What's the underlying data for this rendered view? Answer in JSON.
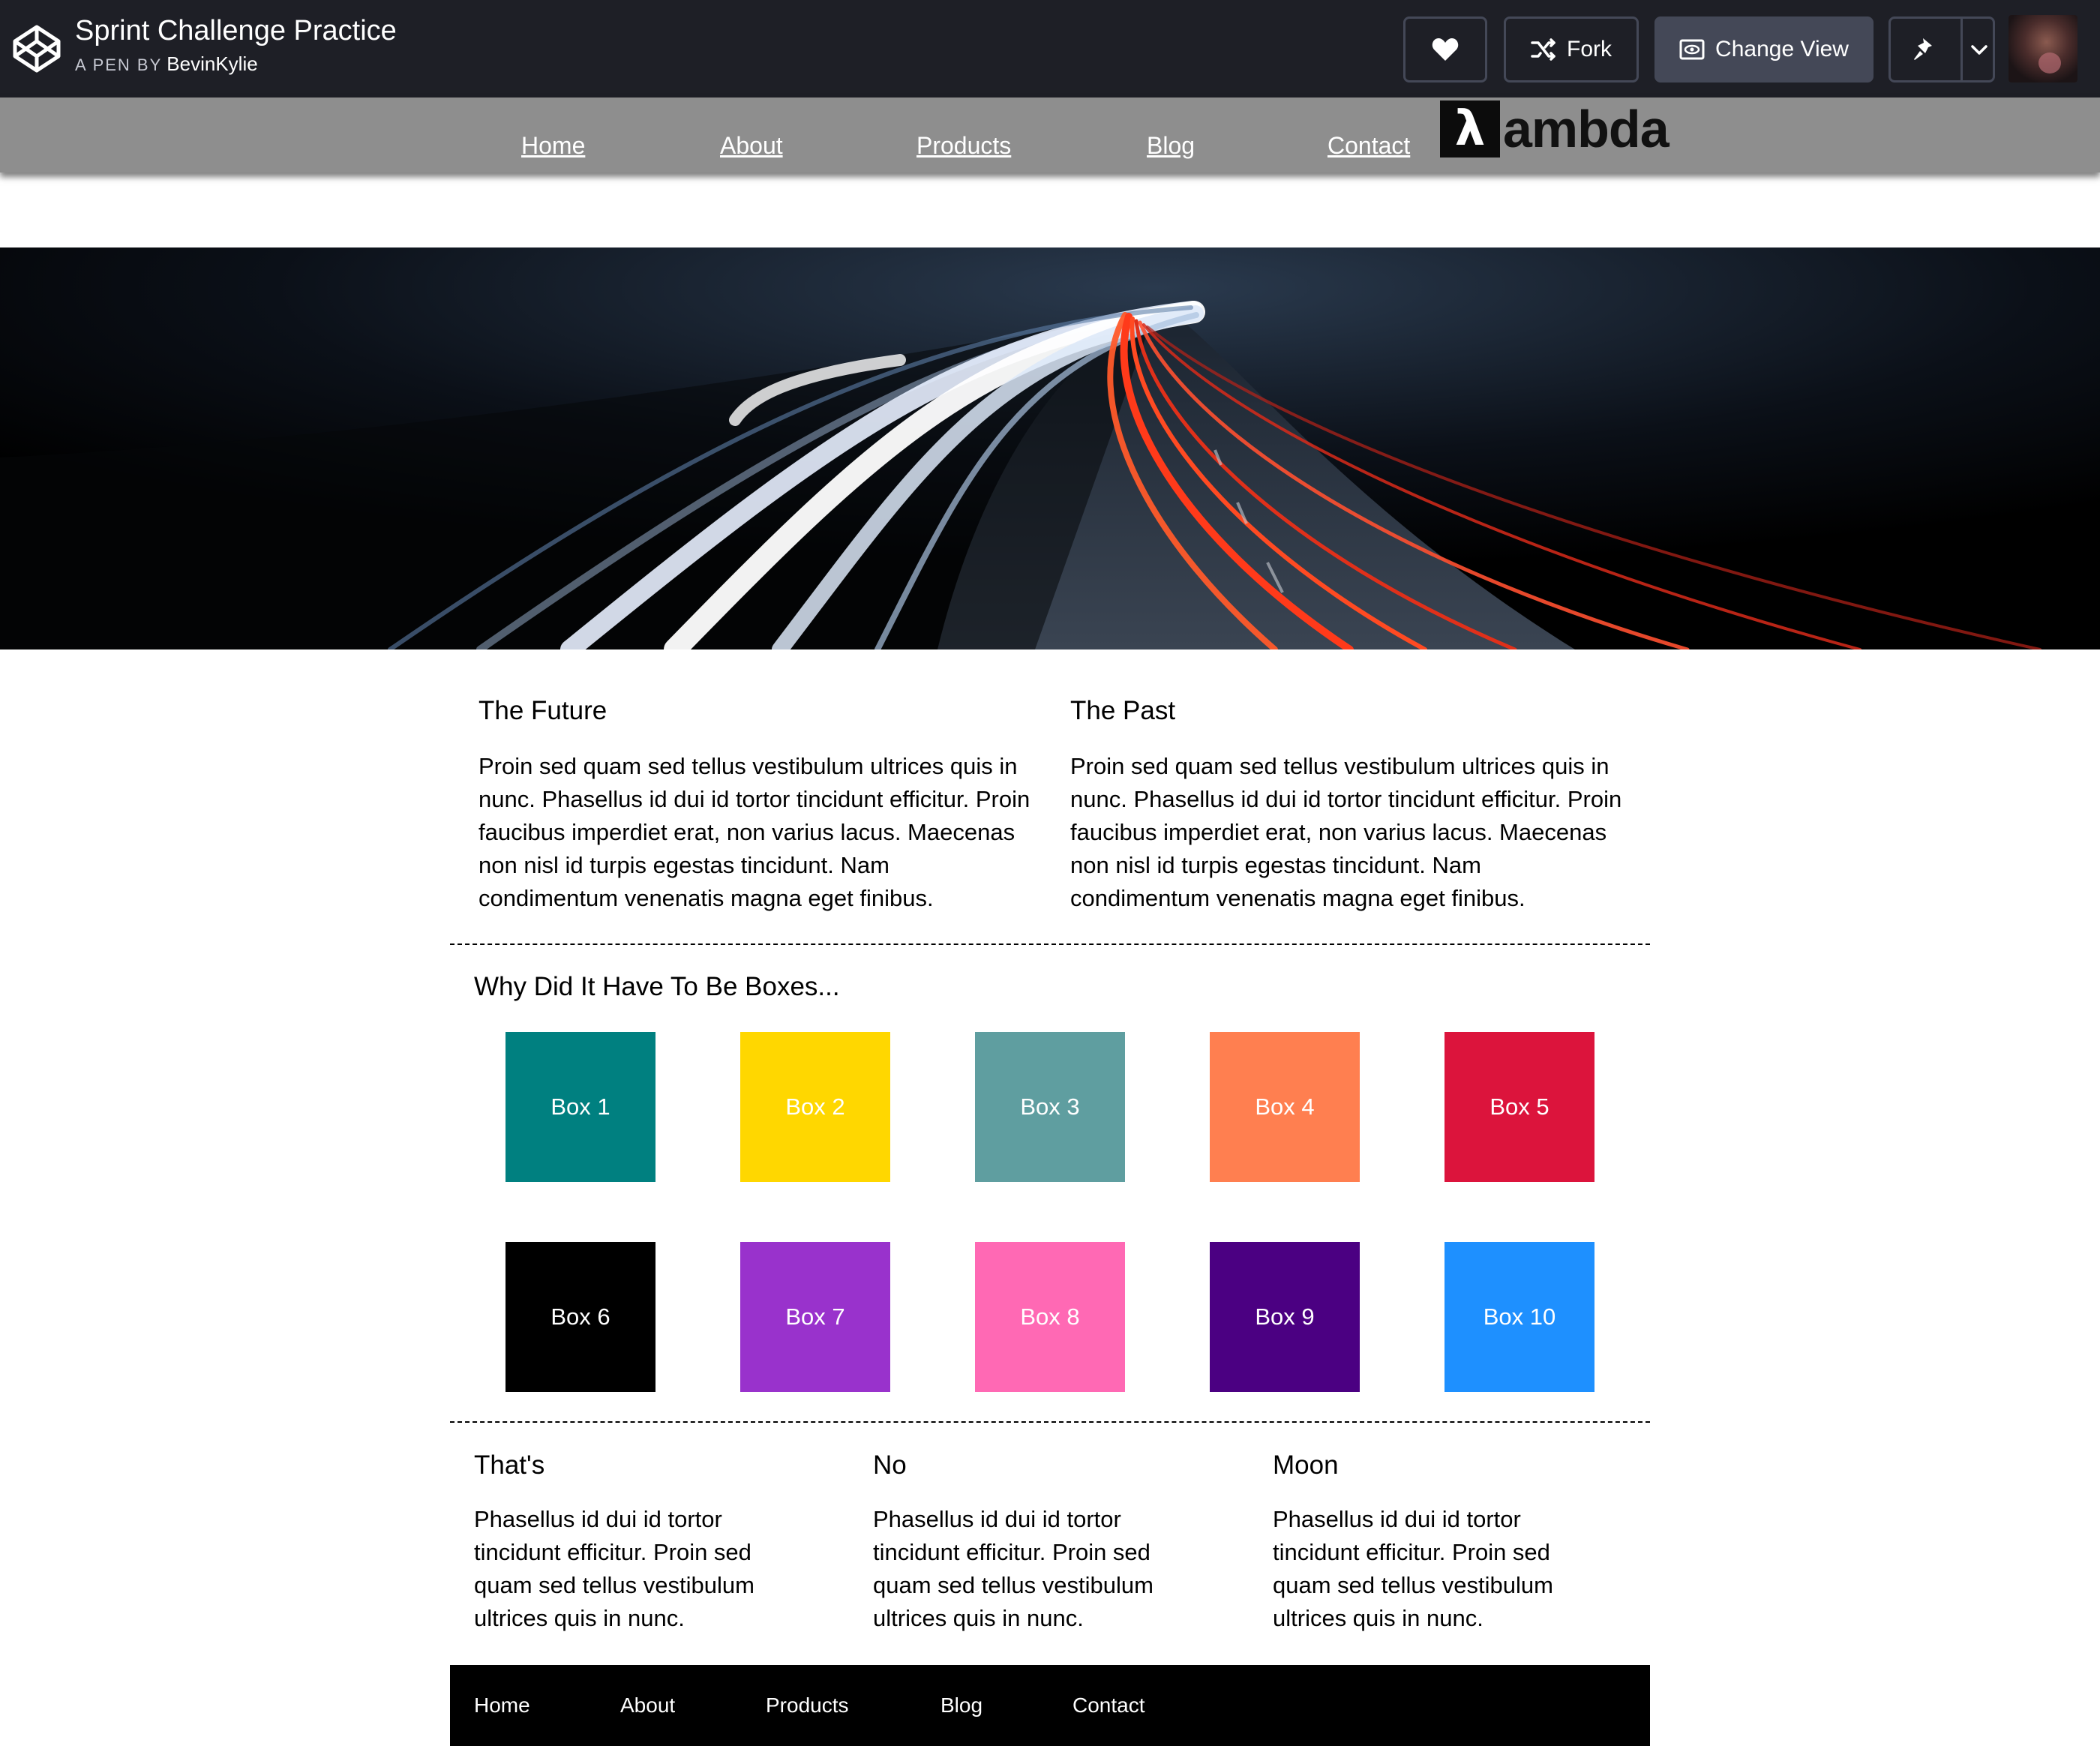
{
  "pen": {
    "title": "Sprint Challenge Practice",
    "by_label": "A PEN BY",
    "author": "BevinKylie"
  },
  "toolbar": {
    "fork_label": "Fork",
    "change_view_label": "Change View",
    "icons": [
      "codepen-logo-icon",
      "heart-icon",
      "fork-icon",
      "eye-icon",
      "pin-icon",
      "chevron-down-icon"
    ]
  },
  "nav": {
    "items": [
      "Home",
      "About",
      "Products",
      "Blog",
      "Contact"
    ],
    "logo_text": "ambda",
    "logo_symbol": "λ"
  },
  "columns": [
    {
      "heading": "The Future",
      "text": "Proin sed quam sed tellus vestibulum ultrices quis in nunc. Phasellus id dui id tortor tincidunt efficitur. Proin faucibus imperdiet erat, non varius lacus. Maecenas non nisl id turpis egestas tincidunt. Nam condimentum venenatis magna eget finibus."
    },
    {
      "heading": "The Past",
      "text": "Proin sed quam sed tellus vestibulum ultrices quis in nunc. Phasellus id dui id tortor tincidunt efficitur. Proin faucibus imperdiet erat, non varius lacus. Maecenas non nisl id turpis egestas tincidunt. Nam condimentum venenatis magna eget finibus."
    }
  ],
  "boxes_section": {
    "heading": "Why Did It Have To Be Boxes...",
    "boxes": [
      {
        "label": "Box 1",
        "color": "#008080"
      },
      {
        "label": "Box 2",
        "color": "#ffd700"
      },
      {
        "label": "Box 3",
        "color": "#5f9ea0"
      },
      {
        "label": "Box 4",
        "color": "#ff7f50"
      },
      {
        "label": "Box 5",
        "color": "#dc143c"
      },
      {
        "label": "Box 6",
        "color": "#000000"
      },
      {
        "label": "Box 7",
        "color": "#9932cc"
      },
      {
        "label": "Box 8",
        "color": "#ff69b4"
      },
      {
        "label": "Box 9",
        "color": "#4b0082"
      },
      {
        "label": "Box 10",
        "color": "#1e90ff"
      }
    ]
  },
  "bottom_columns": [
    {
      "heading": "That's",
      "text": "Phasellus id dui id tortor tincidunt efficitur. Proin sed quam sed tellus vestibulum ultrices quis in nunc."
    },
    {
      "heading": "No",
      "text": "Phasellus id dui id tortor tincidunt efficitur. Proin sed quam sed tellus vestibulum ultrices quis in nunc."
    },
    {
      "heading": "Moon",
      "text": "Phasellus id dui id tortor tincidunt efficitur. Proin sed quam sed tellus vestibulum ultrices quis in nunc."
    }
  ],
  "footer": {
    "items": [
      "Home",
      "About",
      "Products",
      "Blog",
      "Contact"
    ]
  }
}
